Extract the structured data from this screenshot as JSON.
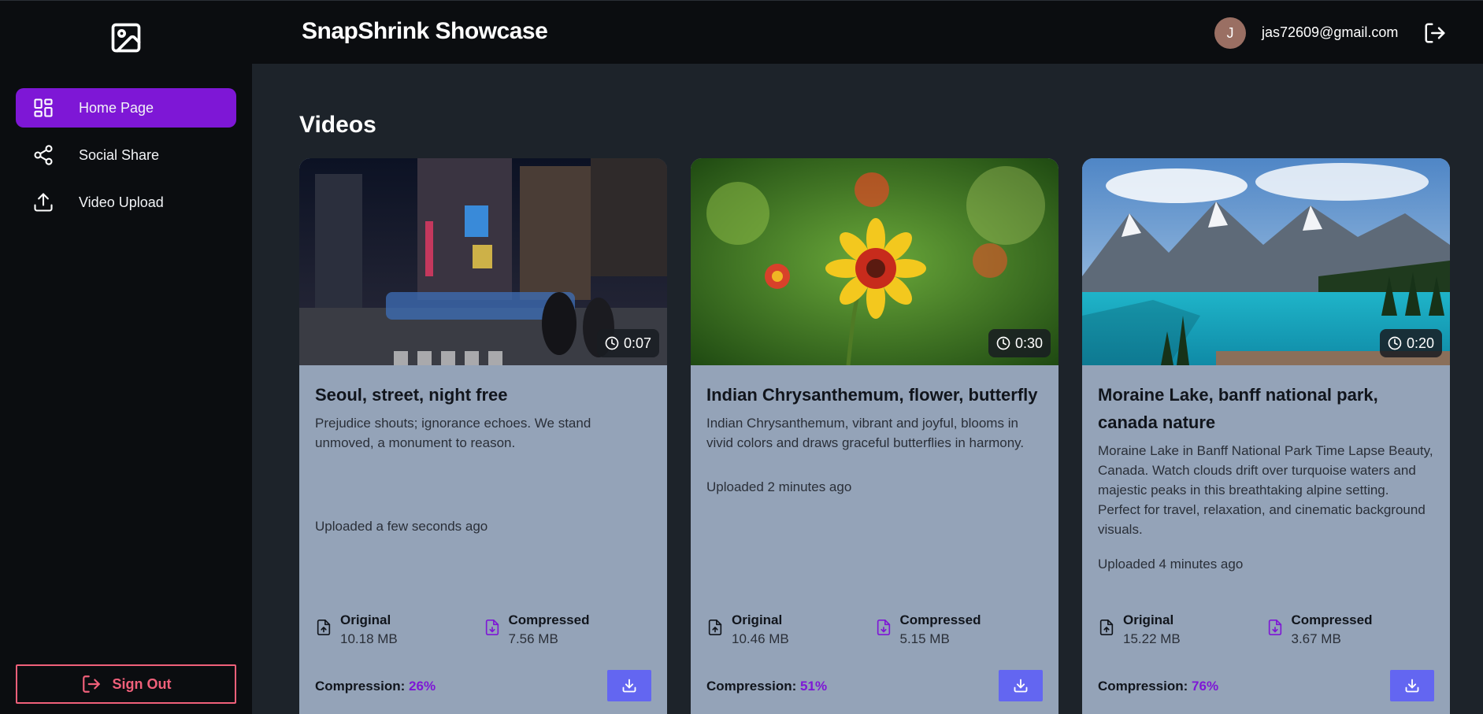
{
  "sidebar": {
    "items": [
      {
        "label": "Home Page",
        "icon": "layout-dashboard-icon",
        "active": true
      },
      {
        "label": "Social Share",
        "icon": "share-icon",
        "active": false
      },
      {
        "label": "Video Upload",
        "icon": "upload-icon",
        "active": false
      }
    ],
    "sign_out_label": "Sign Out"
  },
  "header": {
    "title": "SnapShrink Showcase",
    "avatar_initial": "J",
    "email": "jas72609@gmail.com"
  },
  "main": {
    "section_title": "Videos",
    "labels": {
      "original": "Original",
      "compressed": "Compressed",
      "compression": "Compression:"
    },
    "videos": [
      {
        "title": "Seoul, street, night free",
        "description": "Prejudice shouts; ignorance echoes. We stand unmoved, a monument to reason.",
        "uploaded": "Uploaded a few seconds ago",
        "duration": "0:07",
        "original_size": "10.18 MB",
        "compressed_size": "7.56 MB",
        "compression": "26%"
      },
      {
        "title": "Indian Chrysanthemum, flower, butterfly",
        "description": "Indian Chrysanthemum, vibrant and joyful, blooms in vivid colors and draws graceful butterflies in harmony.",
        "uploaded": "Uploaded 2 minutes ago",
        "duration": "0:30",
        "original_size": "10.46 MB",
        "compressed_size": "5.15 MB",
        "compression": "51%"
      },
      {
        "title": "Moraine Lake, banff national park, canada nature",
        "description": "Moraine Lake in Banff National Park Time Lapse Beauty, Canada. Watch clouds drift over turquoise waters and majestic peaks in this breathtaking alpine setting. Perfect for travel, relaxation, and cinematic background visuals.",
        "uploaded": "Uploaded 4 minutes ago",
        "duration": "0:20",
        "original_size": "15.22 MB",
        "compressed_size": "3.67 MB",
        "compression": "76%"
      }
    ]
  },
  "colors": {
    "accent": "#7e17d6",
    "sign_out": "#f0607a",
    "download": "#6366f1",
    "card_bg": "#94a3b8"
  }
}
